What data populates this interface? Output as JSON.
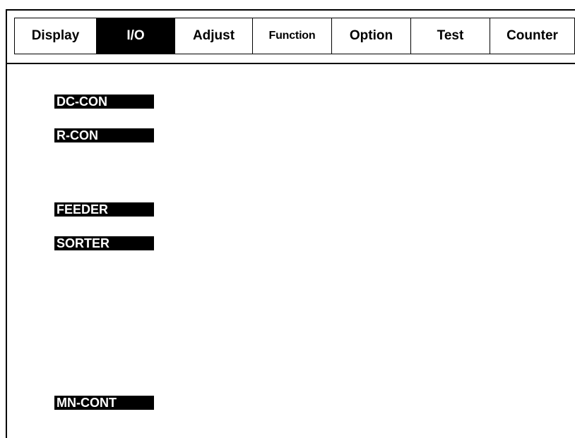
{
  "tabs": [
    {
      "label": "Display",
      "active": false
    },
    {
      "label": "I/O",
      "active": true
    },
    {
      "label": "Adjust",
      "active": false
    },
    {
      "label": "Function",
      "active": false
    },
    {
      "label": "Option",
      "active": false
    },
    {
      "label": "Test",
      "active": false
    },
    {
      "label": "Counter",
      "active": false
    }
  ],
  "io_items": [
    {
      "label": "DC-CON"
    },
    {
      "label": "R-CON"
    },
    {
      "label": "FEEDER"
    },
    {
      "label": "SORTER"
    },
    {
      "label": "MN-CONT"
    }
  ],
  "colors": {
    "active_tab_bg": "#000000",
    "active_tab_text": "#ffffff",
    "label_bg": "#000000",
    "label_text": "#ffffff"
  }
}
